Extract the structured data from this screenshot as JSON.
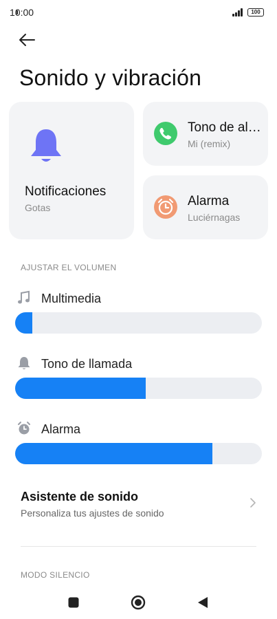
{
  "status_bar": {
    "time": "10:00",
    "battery": "100"
  },
  "header": {
    "title": "Sonido y vibración"
  },
  "cards": {
    "notifications": {
      "title": "Notificaciones",
      "subtitle": "Gotas",
      "icon": "bell-icon",
      "color": "#6e74f5"
    },
    "ringtone": {
      "title": "Tono de alarma",
      "subtitle": "Mi (remix)",
      "icon": "phone-icon",
      "color": "#3fca6d"
    },
    "alarm": {
      "title": "Alarma",
      "subtitle": "Luciérnagas",
      "icon": "alarm-clock-icon",
      "color": "#f19a73"
    }
  },
  "volume": {
    "section_label": "AJUSTAR EL VOLUMEN",
    "accent_color": "#1681f5",
    "items": [
      {
        "label": "Multimedia",
        "icon": "music-note-icon",
        "level": 0.07
      },
      {
        "label": "Tono de llamada",
        "icon": "bell-icon",
        "level": 0.53
      },
      {
        "label": "Alarma",
        "icon": "alarm-clock-icon",
        "level": 0.8
      }
    ]
  },
  "assistant": {
    "title": "Asistente de sonido",
    "subtitle": "Personaliza tus ajustes de sonido"
  },
  "silent_section": {
    "label": "MODO SILENCIO"
  },
  "nav": {
    "recents": "square-icon",
    "home": "circle-icon",
    "back": "triangle-back-icon"
  }
}
